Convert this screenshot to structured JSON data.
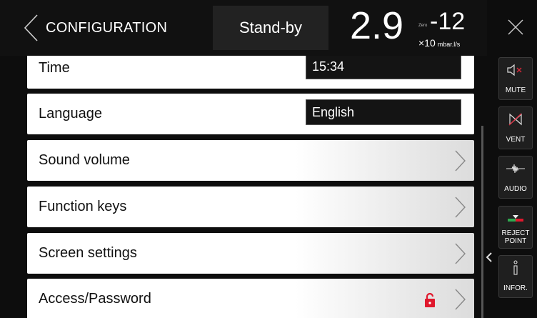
{
  "header": {
    "title": "CONFIGURATION",
    "status": "Stand-by",
    "reading": {
      "mantissa": "2.9",
      "zero_label": "Zero",
      "exponent": "-12",
      "multiplier": "×10",
      "unit": "mbar.l/s"
    }
  },
  "settings": [
    {
      "label": "Time",
      "value": "15:34",
      "type": "field"
    },
    {
      "label": "Language",
      "value": "English",
      "type": "field"
    },
    {
      "label": "Sound volume",
      "type": "nav"
    },
    {
      "label": "Function keys",
      "type": "nav"
    },
    {
      "label": "Screen settings",
      "type": "nav"
    },
    {
      "label": "Access/Password",
      "type": "nav",
      "locked": true
    }
  ],
  "sidebar": {
    "keys": [
      {
        "label": "MUTE",
        "icon": "speaker-muted-icon"
      },
      {
        "label": "VENT",
        "icon": "vent-valve-icon"
      },
      {
        "label": "AUDIO",
        "icon": "audio-wave-icon"
      },
      {
        "label": "REJECT POINT",
        "icon": "reject-point-icon"
      },
      {
        "label": "INFOR.",
        "icon": "info-icon"
      }
    ]
  },
  "colors": {
    "background": "#0d0d0d",
    "row": "#ffffff",
    "lock": "#e0182d",
    "vent_accent": "#d6283a",
    "reject_green": "#2fa84f",
    "reject_red": "#e0182d"
  }
}
